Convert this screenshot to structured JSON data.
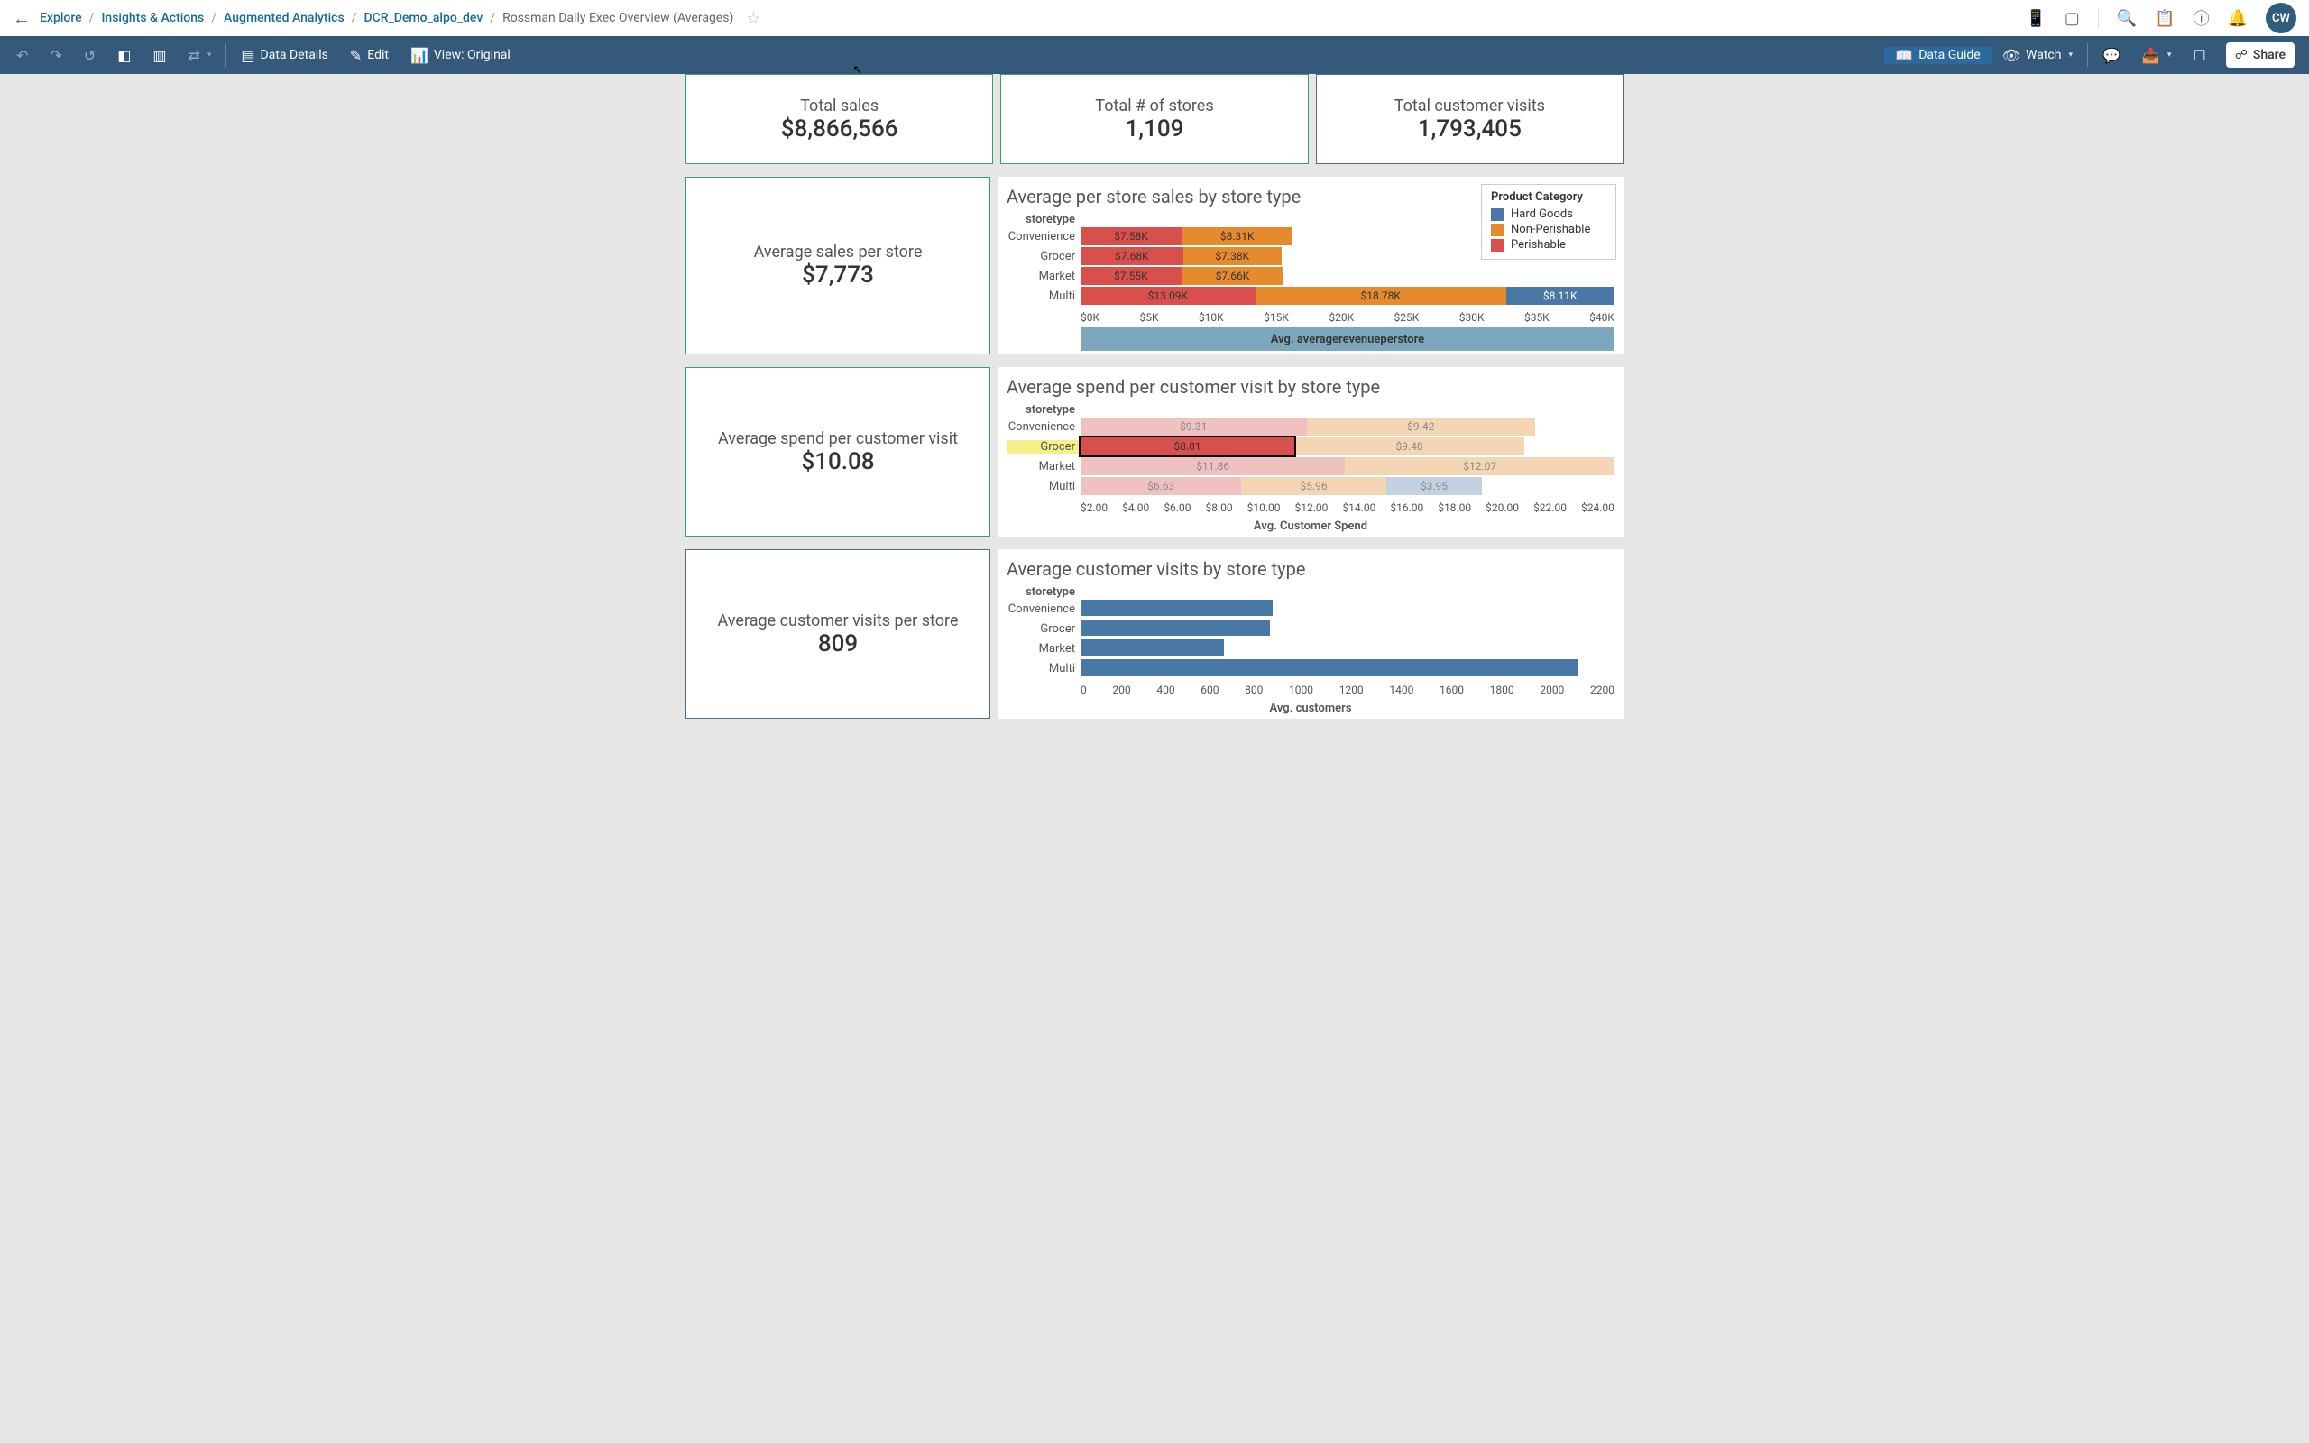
{
  "breadcrumbs": {
    "items": [
      "Explore",
      "Insights & Actions",
      "Augmented Analytics",
      "DCR_Demo_alpo_dev"
    ],
    "current": "Rossman Daily Exec Overview (Averages)"
  },
  "avatar_initials": "CW",
  "toolbar": {
    "data_details": "Data Details",
    "edit": "Edit",
    "view": "View: Original",
    "data_guide": "Data Guide",
    "watch": "Watch",
    "share": "Share"
  },
  "kpi_row": [
    {
      "label": "Total sales",
      "value": "$8,866,566",
      "border": "green"
    },
    {
      "label": "Total # of stores",
      "value": "1,109",
      "border": "green"
    },
    {
      "label": "Total customer visits",
      "value": "1,793,405",
      "border": "blue"
    }
  ],
  "panels": [
    {
      "side": {
        "label": "Average sales per store",
        "value": "$7,773",
        "border": "green"
      },
      "chart": 0
    },
    {
      "side": {
        "label": "Average spend per customer visit",
        "value": "$10.08",
        "border": "green"
      },
      "chart": 1
    },
    {
      "side": {
        "label": "Average customer visits per store",
        "value": "809",
        "border": "blue"
      },
      "chart": 2
    }
  ],
  "legend": {
    "title": "Product Category",
    "items": [
      {
        "name": "Hard Goods",
        "color": "#4a78a6"
      },
      {
        "name": "Non-Perishable",
        "color": "#e68a2e"
      },
      {
        "name": "Perishable",
        "color": "#d94f4b"
      }
    ]
  },
  "chart_data": [
    {
      "type": "bar",
      "title": "Average per store sales by store type",
      "cat_label": "storetype",
      "categories": [
        "Convenience",
        "Grocer",
        "Market",
        "Multi"
      ],
      "stack_order": [
        "Perishable",
        "Non-Perishable",
        "Hard Goods"
      ],
      "series": [
        {
          "name": "Perishable",
          "values": [
            7.58,
            7.68,
            7.55,
            13.09
          ]
        },
        {
          "name": "Non-Perishable",
          "values": [
            8.31,
            7.38,
            7.66,
            18.78
          ]
        },
        {
          "name": "Hard Goods",
          "values": [
            0,
            0,
            0,
            8.11
          ]
        }
      ],
      "value_fmt_prefix": "$",
      "value_fmt_suffix": "K",
      "xlim": [
        0,
        40
      ],
      "xticks": [
        "$0K",
        "$5K",
        "$10K",
        "$15K",
        "$20K",
        "$25K",
        "$30K",
        "$35K",
        "$40K"
      ],
      "xlabel": "Avg. averagerevenueperstore",
      "xlabel_style": "band"
    },
    {
      "type": "bar",
      "title": "Average spend per customer visit by store type",
      "cat_label": "storetype",
      "categories": [
        "Convenience",
        "Grocer",
        "Market",
        "Multi"
      ],
      "stack_order": [
        "Perishable",
        "Non-Perishable",
        "Hard Goods"
      ],
      "series": [
        {
          "name": "Perishable",
          "values": [
            9.31,
            8.81,
            11.86,
            6.63
          ]
        },
        {
          "name": "Non-Perishable",
          "values": [
            9.42,
            9.48,
            12.07,
            5.96
          ]
        },
        {
          "name": "Hard Goods",
          "values": [
            0,
            0,
            0,
            3.95
          ]
        }
      ],
      "value_fmt_prefix": "$",
      "value_fmt_suffix": "",
      "xlim": [
        2,
        24
      ],
      "xticks": [
        "$2.00",
        "$4.00",
        "$6.00",
        "$8.00",
        "$10.00",
        "$12.00",
        "$14.00",
        "$16.00",
        "$18.00",
        "$20.00",
        "$22.00",
        "$24.00"
      ],
      "xlabel": "Avg. Customer Spend",
      "selected": {
        "category": "Grocer",
        "segment": "Perishable"
      }
    },
    {
      "type": "bar",
      "title": "Average customer visits by store type",
      "cat_label": "storetype",
      "categories": [
        "Convenience",
        "Grocer",
        "Market",
        "Multi"
      ],
      "values": [
        790,
        780,
        590,
        2050
      ],
      "xlim": [
        0,
        2200
      ],
      "xticks": [
        "0",
        "200",
        "400",
        "600",
        "800",
        "1000",
        "1200",
        "1400",
        "1600",
        "1800",
        "2000",
        "2200"
      ],
      "xlabel": "Avg. customers"
    }
  ]
}
